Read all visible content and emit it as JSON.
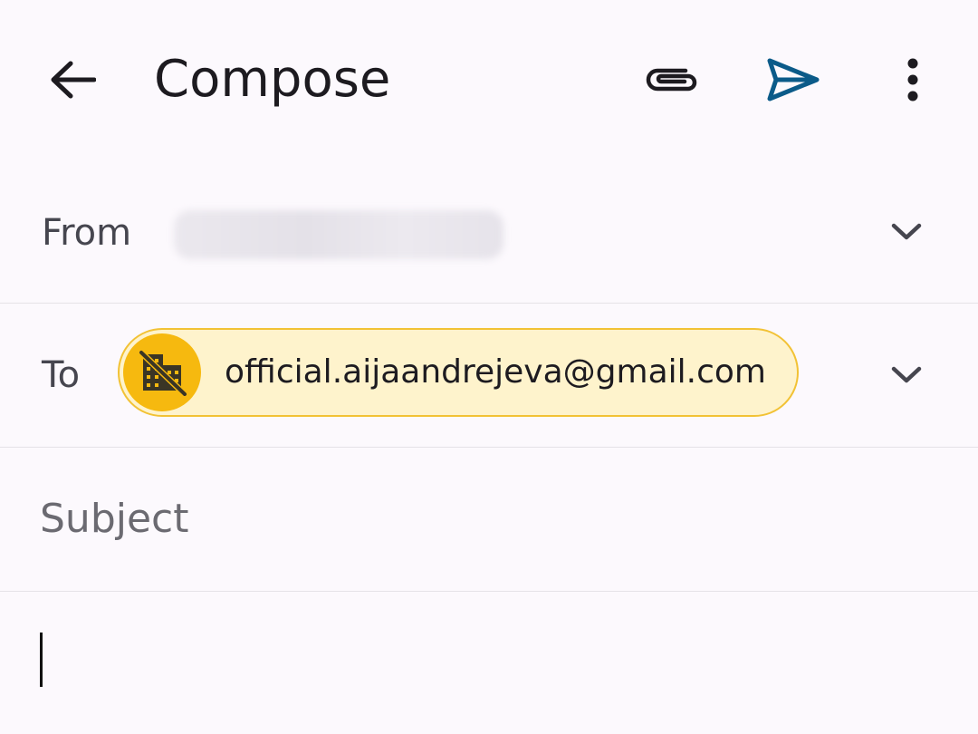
{
  "header": {
    "title": "Compose",
    "icons": {
      "back": "arrow-back-icon",
      "attach": "paperclip-icon",
      "send": "send-icon",
      "more": "more-vert-icon"
    },
    "colors": {
      "send_icon": "#0b5b89",
      "icon": "#1d1b20"
    }
  },
  "from_row": {
    "label": "From",
    "value_obscured": true
  },
  "to_row": {
    "label": "To",
    "recipient": {
      "email": "official.aijaandrejeva@gmail.com",
      "avatar_icon": "domain-disabled-icon",
      "chip_background": "#fef3cc",
      "chip_border": "#f2c235",
      "avatar_background": "#f6b90f"
    }
  },
  "subject_row": {
    "placeholder": "Subject",
    "value": ""
  },
  "body": {
    "value": ""
  },
  "colors": {
    "background": "#fcf9fd",
    "divider": "#e5e2e7",
    "label": "#46464f"
  }
}
